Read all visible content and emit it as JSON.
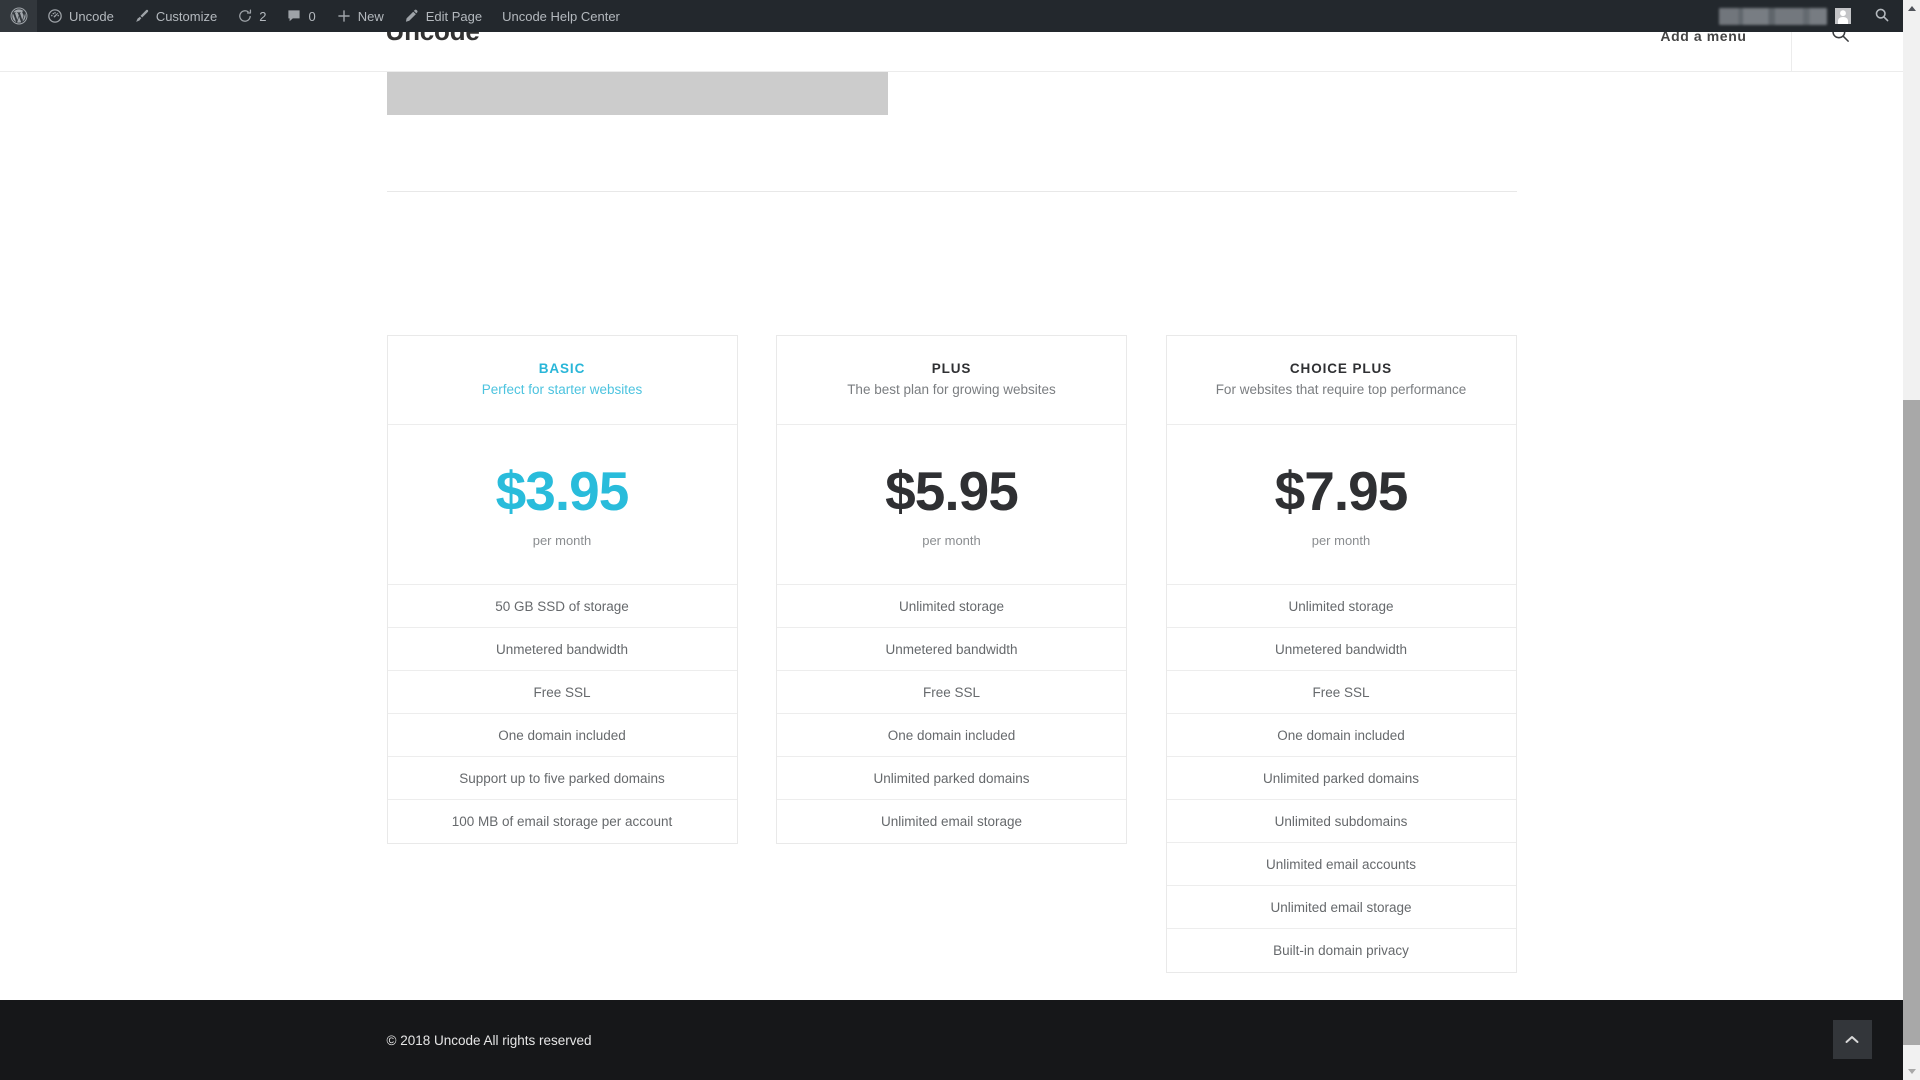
{
  "adminbar": {
    "items": [
      {
        "label": "Uncode",
        "icon": "dashboard-icon"
      },
      {
        "label": "Customize",
        "icon": "paintbrush-icon"
      },
      {
        "label": "2",
        "icon": "updates-icon"
      },
      {
        "label": "0",
        "icon": "comment-bubble-icon"
      },
      {
        "label": "New",
        "icon": "plus-icon"
      },
      {
        "label": "Edit Page",
        "icon": "pencil-icon"
      },
      {
        "label": "Uncode Help Center",
        "icon": "none"
      }
    ],
    "wp_logo": "wordpress-logo-icon",
    "account_name": "",
    "search_icon": "search-icon"
  },
  "header": {
    "site_title": "Uncode",
    "add_menu_label": "Add a menu",
    "search_icon": "search-icon"
  },
  "pricing": {
    "plans": [
      {
        "name": "BASIC",
        "tagline": "Perfect for starter websites",
        "price": "$3.95",
        "period": "per month",
        "accent": "#29bcdb",
        "features": [
          "50 GB SSD of storage",
          "Unmetered bandwidth",
          "Free SSL",
          "One domain included",
          "Support up to five parked domains",
          "100 MB of email storage per account"
        ]
      },
      {
        "name": "PLUS",
        "tagline": "The best plan for growing websites",
        "price": "$5.95",
        "period": "per month",
        "accent": "#2f3033",
        "features": [
          "Unlimited storage",
          "Unmetered bandwidth",
          "Free SSL",
          "One domain included",
          "Unlimited parked domains",
          "Unlimited email storage"
        ]
      },
      {
        "name": "CHOICE PLUS",
        "tagline": "For websites that require top performance",
        "price": "$7.95",
        "period": "per month",
        "accent": "#2f3033",
        "features": [
          "Unlimited storage",
          "Unmetered bandwidth",
          "Free SSL",
          "One domain included",
          "Unlimited parked domains",
          "Unlimited subdomains",
          "Unlimited email accounts",
          "Unlimited email storage",
          "Built-in domain privacy"
        ]
      }
    ]
  },
  "footer": {
    "copyright": "© 2018 Uncode All rights reserved",
    "back_to_top_icon": "chevron-up-icon"
  },
  "scrollbar": {
    "up_icon": "scroll-up-arrow-icon",
    "down_icon": "scroll-down-arrow-icon"
  }
}
